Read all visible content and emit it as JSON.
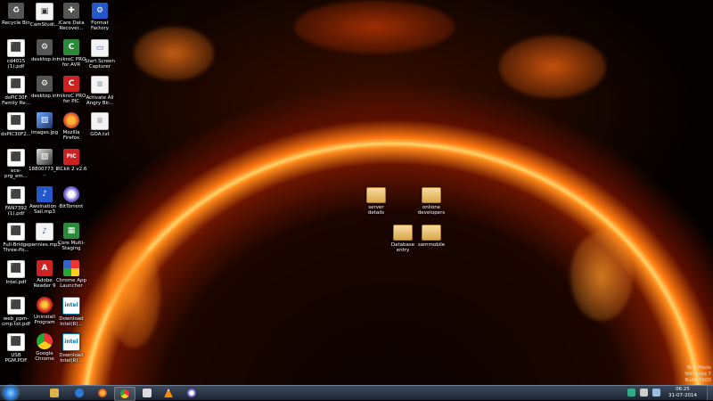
{
  "desktop": {
    "icons": [
      {
        "label": "Recycle Bin",
        "icon": "recycle-bin-icon"
      },
      {
        "label": "CamStudi...",
        "icon": "camstudio-icon"
      },
      {
        "label": "iCare Data Recover...",
        "icon": "icare-icon"
      },
      {
        "label": "Format Factory",
        "icon": "format-factory-icon"
      },
      {
        "label": "cd4015 (1).pdf",
        "icon": "pdf-icon"
      },
      {
        "label": "desktop.ini",
        "icon": "ini-file-icon"
      },
      {
        "label": "mikroC PRO for AVR",
        "icon": "mikroc-icon"
      },
      {
        "label": "Start Screen Capturer",
        "icon": "screen-capture-icon"
      },
      {
        "label": "dsPIC30F Family Re...",
        "icon": "pdf-icon"
      },
      {
        "label": "desktop.ini",
        "icon": "ini-file-icon"
      },
      {
        "label": "mikroC PRO for PIC",
        "icon": "mikroc-icon"
      },
      {
        "label": "Activate All Angry Bir...",
        "icon": "text-file-icon"
      },
      {
        "label": "dsPIC30F2...",
        "icon": "pdf-icon"
      },
      {
        "label": "images.jpg",
        "icon": "image-file-icon"
      },
      {
        "label": "Mozilla Firefox",
        "icon": "firefox-icon"
      },
      {
        "label": "GOA.txt",
        "icon": "text-file-icon"
      },
      {
        "label": "ece-prg_em...",
        "icon": "pdf-icon"
      },
      {
        "label": "18800773_1...",
        "icon": "image-file-icon"
      },
      {
        "label": "PICkit 2 v2.6",
        "icon": "pickit-icon"
      },
      {
        "label": "FAN7392 (1).pdf",
        "icon": "pdf-icon"
      },
      {
        "label": "Awolnation - Sail.mp3",
        "icon": "audio-file-icon"
      },
      {
        "label": "BitTorrent",
        "icon": "bittorrent-icon"
      },
      {
        "label": "Full-Bridge Three-Po...",
        "icon": "pdf-icon"
      },
      {
        "label": "pennies.mp3",
        "icon": "audio-file-icon"
      },
      {
        "label": "Core Multi-Staging",
        "icon": "app-icon"
      },
      {
        "label": "Intel.pdf",
        "icon": "pdf-icon"
      },
      {
        "label": "Adobe Reader 9",
        "icon": "adobe-reader-icon"
      },
      {
        "label": "Chrome App Launcher",
        "icon": "app-launcher-icon"
      },
      {
        "label": "web_ppm-cmp.txt.pdf",
        "icon": "pdf-icon"
      },
      {
        "label": "Uninstall Program",
        "icon": "uninstall-icon"
      },
      {
        "label": "Download Intel(R)...",
        "icon": "intel-icon"
      },
      {
        "label": "USB PGM.PDF",
        "icon": "pdf-icon"
      },
      {
        "label": "Google Chrome",
        "icon": "chrome-icon"
      },
      {
        "label": "Download Intel(R)...",
        "icon": "intel-icon"
      }
    ],
    "folders": [
      {
        "label": "server details"
      },
      {
        "label": "onlione developers"
      },
      {
        "label": "Database entry"
      },
      {
        "label": "sammobile"
      }
    ]
  },
  "watermark": {
    "line1": "Test Mode",
    "line2": "Windows 7",
    "line3": "Build 7600"
  },
  "taskbar": {
    "buttons": [
      "start-orb",
      "explorer",
      "media-player",
      "firefox",
      "chrome",
      "vlc",
      "bittorrent"
    ],
    "clock": {
      "time": "06:25",
      "date": "31-07-2014"
    }
  }
}
